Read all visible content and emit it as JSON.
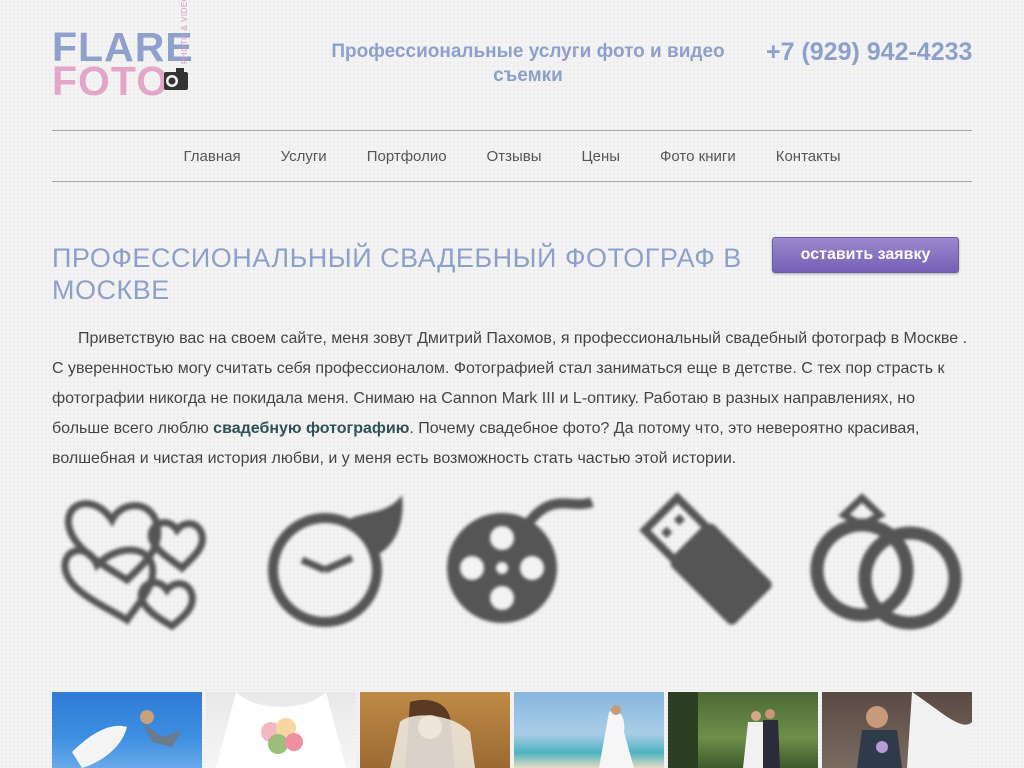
{
  "logo": {
    "line1": "FLARE",
    "line2": "FOTO",
    "sub": "PHOTO & VIDEO"
  },
  "header": {
    "tagline": "Профессиональные услуги фото и видео съемки",
    "phone": "+7 (929) 942-4233"
  },
  "nav": {
    "items": [
      "Главная",
      "Услуги",
      "Портфолио",
      "Отзывы",
      "Цены",
      "Фото книги",
      "Контакты"
    ]
  },
  "main": {
    "title": "ПРОФЕССИОНАЛЬНЫЙ СВАДЕБНЫЙ ФОТОГРАФ В МОСКВЕ",
    "cta_label": "оставить заявку",
    "intro_before": "Приветствую вас на своем сайте, меня зовут Дмитрий Пахомов, я профессиональный свадебный фотограф в Москве . С уверенностью  могу  считать себя профессионалом. Фотографией стал заниматься еще в детстве. С тех пор страсть к фотографии никогда не покидала меня. Снимаю на Cannon Mark III и L-оптику.  Работаю в разных направлениях, но больше всего люблю ",
    "intro_link": "свадебную фотографию",
    "intro_after": ". Почему свадебное фото? Да потому что, это невероятно красивая, волшебная и чистая история любви, и у меня есть возможность стать частью этой истории."
  },
  "features": [
    {
      "icon": "hearts-icon",
      "caption": ""
    },
    {
      "icon": "clock-icon",
      "caption": ""
    },
    {
      "icon": "film-reel-icon",
      "caption": ""
    },
    {
      "icon": "usb-drive-icon",
      "caption": ""
    },
    {
      "icon": "rings-icon",
      "caption": ""
    }
  ],
  "colors": {
    "brand_blue": "#8da0cc",
    "brand_pink": "#e3a6c8",
    "cta_purple": "#7460b5",
    "icon_gray": "#555555",
    "caption_red": "#e57070"
  }
}
